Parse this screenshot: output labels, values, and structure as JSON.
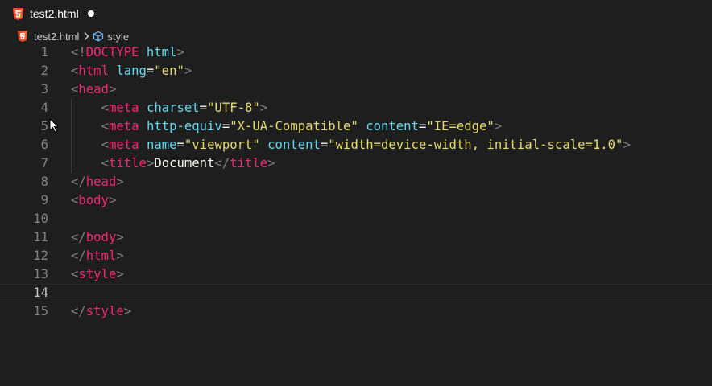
{
  "tab": {
    "filename": "test2.html",
    "modified": true
  },
  "breadcrumb": {
    "file": "test2.html",
    "symbol": "style"
  },
  "colors": {
    "background": "#1e1e1e",
    "tag": "#f92672",
    "attribute": "#66d9ef",
    "string": "#e6db74",
    "text": "#f8f8f2",
    "bracket": "#808080",
    "html5_icon": "#e44d26"
  },
  "editor": {
    "current_line": 14,
    "lines": [
      {
        "number": "1",
        "tokens": [
          [
            "bracket",
            "<!"
          ],
          [
            "doctype",
            "DOCTYPE"
          ],
          [
            "text",
            " "
          ],
          [
            "kw",
            "html"
          ],
          [
            "bracket",
            ">"
          ]
        ]
      },
      {
        "number": "2",
        "tokens": [
          [
            "bracket",
            "<"
          ],
          [
            "tag",
            "html"
          ],
          [
            "text",
            " "
          ],
          [
            "attr",
            "lang"
          ],
          [
            "eq",
            "="
          ],
          [
            "str",
            "\"en\""
          ],
          [
            "bracket",
            ">"
          ]
        ]
      },
      {
        "number": "3",
        "tokens": [
          [
            "bracket",
            "<"
          ],
          [
            "tag",
            "head"
          ],
          [
            "bracket",
            ">"
          ]
        ]
      },
      {
        "number": "4",
        "indent": 1,
        "tokens": [
          [
            "bracket",
            "<"
          ],
          [
            "tag",
            "meta"
          ],
          [
            "text",
            " "
          ],
          [
            "attr",
            "charset"
          ],
          [
            "eq",
            "="
          ],
          [
            "str",
            "\"UTF-8\""
          ],
          [
            "bracket",
            ">"
          ]
        ]
      },
      {
        "number": "5",
        "indent": 1,
        "tokens": [
          [
            "bracket",
            "<"
          ],
          [
            "tag",
            "meta"
          ],
          [
            "text",
            " "
          ],
          [
            "attr",
            "http-equiv"
          ],
          [
            "eq",
            "="
          ],
          [
            "str",
            "\"X-UA-Compatible\""
          ],
          [
            "text",
            " "
          ],
          [
            "attr",
            "content"
          ],
          [
            "eq",
            "="
          ],
          [
            "str",
            "\"IE=edge\""
          ],
          [
            "bracket",
            ">"
          ]
        ]
      },
      {
        "number": "6",
        "indent": 1,
        "tokens": [
          [
            "bracket",
            "<"
          ],
          [
            "tag",
            "meta"
          ],
          [
            "text",
            " "
          ],
          [
            "attr",
            "name"
          ],
          [
            "eq",
            "="
          ],
          [
            "str",
            "\"viewport\""
          ],
          [
            "text",
            " "
          ],
          [
            "attr",
            "content"
          ],
          [
            "eq",
            "="
          ],
          [
            "str",
            "\"width=device-width, initial-scale=1.0\""
          ],
          [
            "bracket",
            ">"
          ]
        ]
      },
      {
        "number": "7",
        "indent": 1,
        "tokens": [
          [
            "bracket",
            "<"
          ],
          [
            "tag",
            "title"
          ],
          [
            "bracket",
            ">"
          ],
          [
            "text",
            "Document"
          ],
          [
            "bracket",
            "</"
          ],
          [
            "tag",
            "title"
          ],
          [
            "bracket",
            ">"
          ]
        ]
      },
      {
        "number": "8",
        "tokens": [
          [
            "bracket",
            "</"
          ],
          [
            "tag",
            "head"
          ],
          [
            "bracket",
            ">"
          ]
        ]
      },
      {
        "number": "9",
        "tokens": [
          [
            "bracket",
            "<"
          ],
          [
            "tag",
            "body"
          ],
          [
            "bracket",
            ">"
          ]
        ]
      },
      {
        "number": "10",
        "tokens": []
      },
      {
        "number": "11",
        "tokens": [
          [
            "bracket",
            "</"
          ],
          [
            "tag",
            "body"
          ],
          [
            "bracket",
            ">"
          ]
        ]
      },
      {
        "number": "12",
        "tokens": [
          [
            "bracket",
            "</"
          ],
          [
            "tag",
            "html"
          ],
          [
            "bracket",
            ">"
          ]
        ]
      },
      {
        "number": "13",
        "tokens": [
          [
            "bracket",
            "<"
          ],
          [
            "tag",
            "style"
          ],
          [
            "bracket",
            ">"
          ]
        ]
      },
      {
        "number": "14",
        "tokens": []
      },
      {
        "number": "15",
        "tokens": [
          [
            "bracket",
            "</"
          ],
          [
            "tag",
            "style"
          ],
          [
            "bracket",
            ">"
          ]
        ]
      }
    ]
  },
  "icons": {
    "file_type": "html5-icon",
    "symbol": "cube-icon",
    "separator": "chevron-right-icon",
    "pointer": "mouse-pointer-icon"
  }
}
